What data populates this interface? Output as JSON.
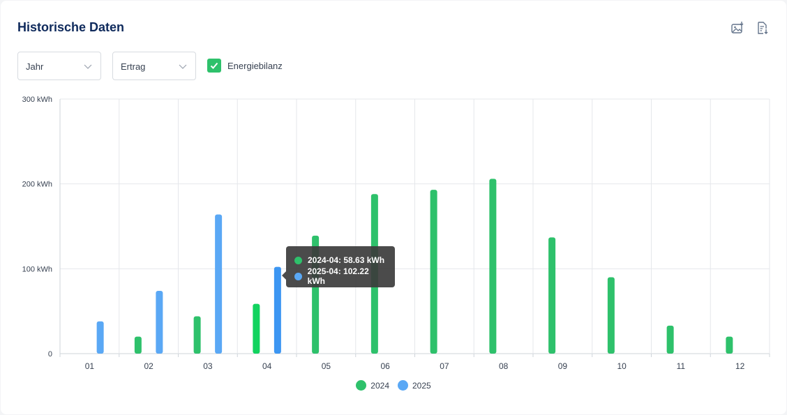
{
  "header": {
    "title": "Historische Daten"
  },
  "controls": {
    "period_select": "Jahr",
    "metric_select": "Ertrag",
    "energy_balance_label": "Energiebilanz",
    "energy_balance_checked": true
  },
  "icons": {
    "export_image": "image-download-icon",
    "export_csv": "file-download-icon"
  },
  "colors": {
    "series_2024": "#2ec16b",
    "series_2025": "#5aa8f5",
    "highlight_2024": "#12d35f",
    "highlight_2025": "#3c96f2",
    "title": "#0f2a5c"
  },
  "chart_data": {
    "type": "bar",
    "categories": [
      "01",
      "02",
      "03",
      "04",
      "05",
      "06",
      "07",
      "08",
      "09",
      "10",
      "11",
      "12"
    ],
    "series": [
      {
        "name": "2024",
        "values": [
          0,
          20,
          44,
          58.63,
          139,
          188,
          193,
          206,
          137,
          90,
          33,
          20
        ]
      },
      {
        "name": "2025",
        "values": [
          38,
          74,
          164,
          102.22,
          0,
          0,
          0,
          0,
          0,
          0,
          0,
          0
        ]
      }
    ],
    "yticks": [
      "0",
      "100 kWh",
      "200 kWh",
      "300 kWh"
    ],
    "ytick_values": [
      0,
      100,
      200,
      300
    ],
    "ylim": [
      0,
      300
    ],
    "grid": true,
    "legend_position": "bottom-center",
    "highlighted_category": "04"
  },
  "tooltip": {
    "row1": "2024-04: 58.63 kWh",
    "row2": "2025-04: 102.22 kWh"
  },
  "legend": [
    {
      "label": "2024"
    },
    {
      "label": "2025"
    }
  ]
}
